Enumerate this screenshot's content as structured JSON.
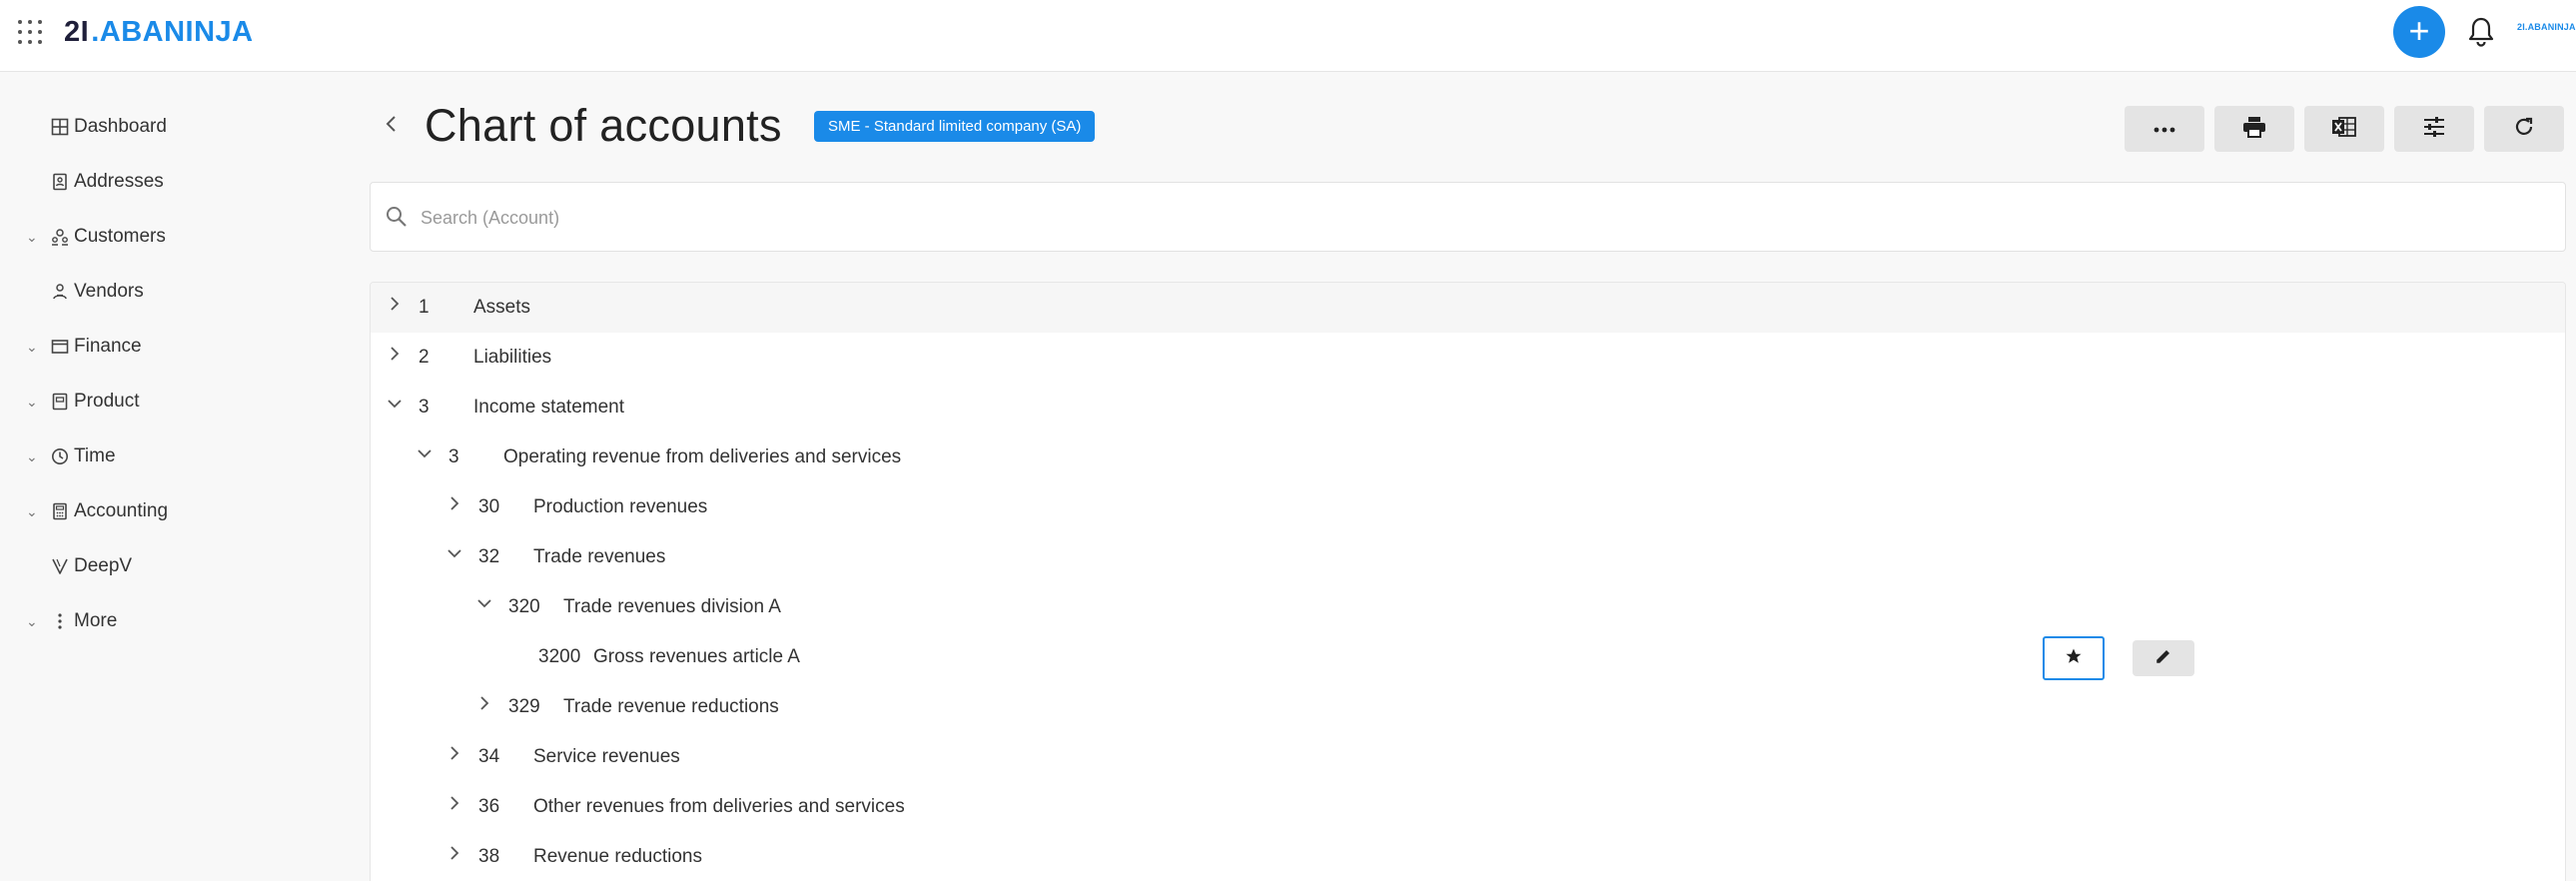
{
  "header": {
    "logo_mark": "2I",
    "logo_dot": ".",
    "logo_text": "ABANINJA",
    "mini_logo": "2I.ABANINJA",
    "add_symbol": "+"
  },
  "sidebar": {
    "items": [
      {
        "label": "Dashboard",
        "icon": "dashboard-icon",
        "expandable": false
      },
      {
        "label": "Addresses",
        "icon": "address-book-icon",
        "expandable": false
      },
      {
        "label": "Customers",
        "icon": "customers-icon",
        "expandable": true
      },
      {
        "label": "Vendors",
        "icon": "vendors-icon",
        "expandable": false
      },
      {
        "label": "Finance",
        "icon": "finance-icon",
        "expandable": true
      },
      {
        "label": "Product",
        "icon": "product-icon",
        "expandable": true
      },
      {
        "label": "Time",
        "icon": "clock-icon",
        "expandable": true
      },
      {
        "label": "Accounting",
        "icon": "calculator-icon",
        "expandable": true
      },
      {
        "label": "DeepV",
        "icon": "deepv-icon",
        "expandable": false
      },
      {
        "label": "More",
        "icon": "more-vertical-icon",
        "expandable": true
      }
    ]
  },
  "page": {
    "title": "Chart of accounts",
    "badge": "SME - Standard limited company (SA)"
  },
  "toolbar": {
    "buttons": [
      {
        "name": "more-actions-button",
        "icon": "ellipsis-icon"
      },
      {
        "name": "print-button",
        "icon": "print-icon"
      },
      {
        "name": "excel-export-button",
        "icon": "excel-icon"
      },
      {
        "name": "filter-settings-button",
        "icon": "sliders-icon"
      },
      {
        "name": "refresh-button",
        "icon": "refresh-icon"
      }
    ]
  },
  "search": {
    "placeholder": "Search (Account)",
    "value": ""
  },
  "tree": {
    "rows": [
      {
        "number": "1",
        "name": "Assets",
        "level": 0,
        "state": "collapsed"
      },
      {
        "number": "2",
        "name": "Liabilities",
        "level": 0,
        "state": "collapsed"
      },
      {
        "number": "3",
        "name": "Income statement",
        "level": 0,
        "state": "expanded"
      },
      {
        "number": "3",
        "name": "Operating revenue from deliveries and services",
        "level": 1,
        "state": "expanded"
      },
      {
        "number": "30",
        "name": "Production revenues",
        "level": 2,
        "state": "collapsed"
      },
      {
        "number": "32",
        "name": "Trade revenues",
        "level": 2,
        "state": "expanded"
      },
      {
        "number": "320",
        "name": "Trade revenues division A",
        "level": 3,
        "state": "expanded"
      },
      {
        "number": "3200",
        "name": "Gross revenues article A",
        "level": 4,
        "state": "leaf"
      },
      {
        "number": "329",
        "name": "Trade revenue reductions",
        "level": 3,
        "state": "collapsed"
      },
      {
        "number": "34",
        "name": "Service revenues",
        "level": 2,
        "state": "collapsed"
      },
      {
        "number": "36",
        "name": "Other revenues from deliveries and services",
        "level": 2,
        "state": "collapsed"
      },
      {
        "number": "38",
        "name": "Revenue reductions",
        "level": 2,
        "state": "collapsed"
      }
    ]
  },
  "row_actions": {
    "favorite_icon": "star-icon",
    "edit_icon": "pencil-icon"
  },
  "colors": {
    "accent": "#1a8ae8",
    "background": "#f8f8f8",
    "button_gray": "#e4e4e4"
  }
}
